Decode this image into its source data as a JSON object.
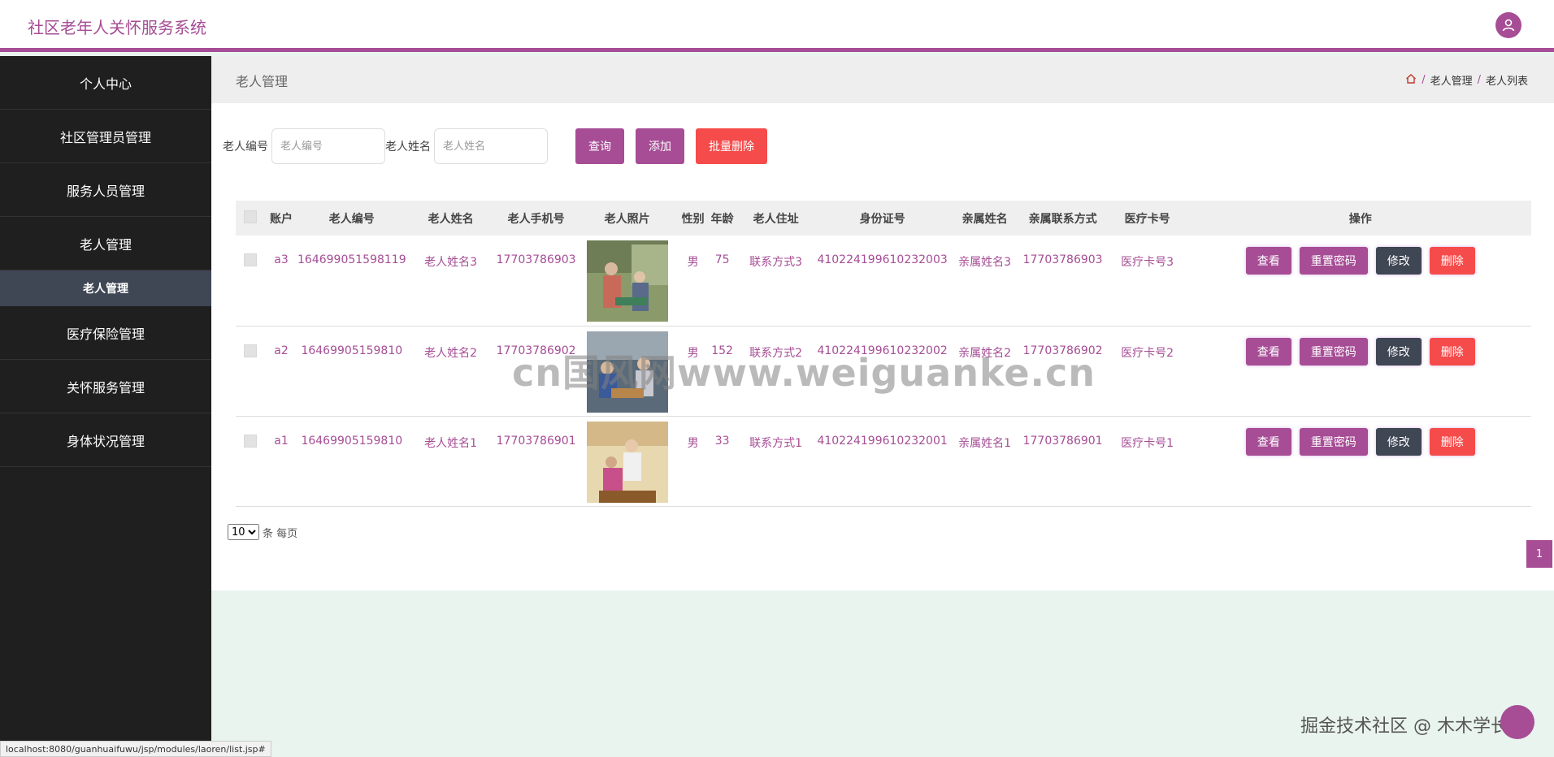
{
  "app": {
    "title": "社区老年人关怀服务系统"
  },
  "sidebar": {
    "items": [
      {
        "label": "个人中心",
        "name": "sidebar-item-personal-center"
      },
      {
        "label": "社区管理员管理",
        "name": "sidebar-item-community-admins"
      },
      {
        "label": "服务人员管理",
        "name": "sidebar-item-service-staff"
      },
      {
        "label": "老人管理",
        "name": "sidebar-item-elderly"
      },
      {
        "label": "医疗保险管理",
        "name": "sidebar-item-medical-insurance"
      },
      {
        "label": "关怀服务管理",
        "name": "sidebar-item-care-services"
      },
      {
        "label": "身体状况管理",
        "name": "sidebar-item-health-status"
      }
    ],
    "sub_item": "老人管理"
  },
  "header": {
    "page_title": "老人管理",
    "breadcrumb": [
      "老人管理",
      "老人列表"
    ]
  },
  "search": {
    "id_label": "老人编号",
    "id_placeholder": "老人编号",
    "name_label": "老人姓名",
    "name_placeholder": "老人姓名",
    "query_btn": "查询",
    "add_btn": "添加",
    "batch_delete_btn": "批量删除"
  },
  "table": {
    "columns": [
      "账户",
      "老人编号",
      "老人姓名",
      "老人手机号",
      "老人照片",
      "性别",
      "年龄",
      "老人住址",
      "身份证号",
      "亲属姓名",
      "亲属联系方式",
      "医疗卡号",
      "操作"
    ],
    "actions": {
      "view": "查看",
      "reset": "重置密码",
      "edit": "修改",
      "delete": "删除"
    },
    "rows": [
      {
        "account": "a3",
        "code": "164699051598119",
        "name": "老人姓名3",
        "phone": "17703786903",
        "photo": "photo-elderly-3",
        "gender": "男",
        "age": "75",
        "address": "联系方式3",
        "idcard": "410224199610232003",
        "relative": "亲属姓名3",
        "relative_phone": "17703786903",
        "card": "医疗卡号3"
      },
      {
        "account": "a2",
        "code": "16469905159810",
        "name": "老人姓名2",
        "phone": "17703786902",
        "photo": "photo-elderly-2",
        "gender": "男",
        "age": "152",
        "address": "联系方式2",
        "idcard": "410224199610232002",
        "relative": "亲属姓名2",
        "relative_phone": "17703786902",
        "card": "医疗卡号2"
      },
      {
        "account": "a1",
        "code": "16469905159810",
        "name": "老人姓名1",
        "phone": "17703786901",
        "photo": "photo-elderly-1",
        "gender": "男",
        "age": "33",
        "address": "联系方式1",
        "idcard": "410224199610232001",
        "relative": "亲属姓名1",
        "relative_phone": "17703786901",
        "card": "医疗卡号1"
      }
    ]
  },
  "pagination": {
    "page_size": "10",
    "per_page_text": "条 每页",
    "current_page": "1"
  },
  "overlay": {
    "watermark": "cn国风网www.weiguanke.cn",
    "footer_mark": "掘金技术社区 @ 木木学长"
  },
  "status_bar": "localhost:8080/guanhuaifuwu/jsp/modules/laoren/list.jsp#",
  "colors": {
    "accent": "#a64d95",
    "danger": "#f54b4b",
    "dark": "#3f4654",
    "sidebar": "#1f1f1f"
  }
}
